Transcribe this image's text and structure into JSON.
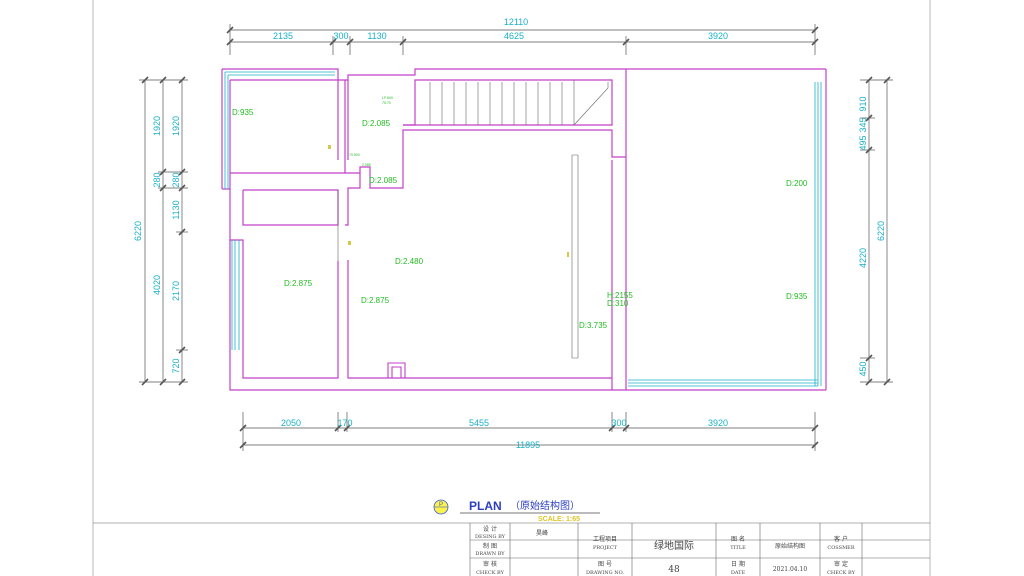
{
  "drawing": {
    "top_dims": {
      "total": "12110",
      "segments": [
        "2135",
        "300",
        "1130",
        "4625",
        "3920"
      ]
    },
    "bottom_dims": {
      "total": "11895",
      "segments": [
        "2050",
        "170",
        "5455",
        "300",
        "3920"
      ]
    },
    "left_dims": {
      "total": "6220",
      "outer_segments": [
        "1920",
        "280",
        "4020"
      ],
      "inner_segments": [
        "1920",
        "280",
        "1130",
        "2170",
        "720"
      ]
    },
    "right_dims": {
      "total": "6220",
      "outer_segments": [
        "910",
        "495",
        "4220",
        "450"
      ],
      "inner_segment": "345"
    },
    "room_labels": [
      "D:935",
      "D:2.085",
      "D:2.085",
      "D:2.875",
      "D:2.480",
      "D:2.875",
      "D:200",
      "D:935",
      "H:2155",
      "D:310",
      "D:3.735"
    ],
    "tiny_labels": [
      "LF 600",
      "75.70",
      "2.085",
      "70.900"
    ]
  },
  "plan_title": {
    "title": "PLAN",
    "subtitle": "（原始结构图）",
    "scale": "SCALE: 1:65",
    "badge": "P"
  },
  "title_block": {
    "design_label": "设    计",
    "design_label_en": "DESING BY",
    "design_value": "昊峰",
    "drawn_label": "制    图",
    "drawn_label_en": "DRAWN BY",
    "check_label": "审    核",
    "check_label_en": "CHECK BY",
    "project_label": "工程项目",
    "project_label_en": "PROJECT",
    "project_value": "绿地国际",
    "drawing_no_label": "图    号",
    "drawing_no_label_en": "DRAWING NO.",
    "drawing_no_value": "48",
    "title_label": "图    名",
    "title_label_en": "TITLE",
    "title_value": "原始结构图",
    "date_label": "日    期",
    "date_label_en": "DATE",
    "date_value": "2021.04.10",
    "customer_label": "客    户",
    "customer_label_en": "COSSMER",
    "checkby2_label": "审    定",
    "checkby2_label_en": "CHECK BY"
  }
}
